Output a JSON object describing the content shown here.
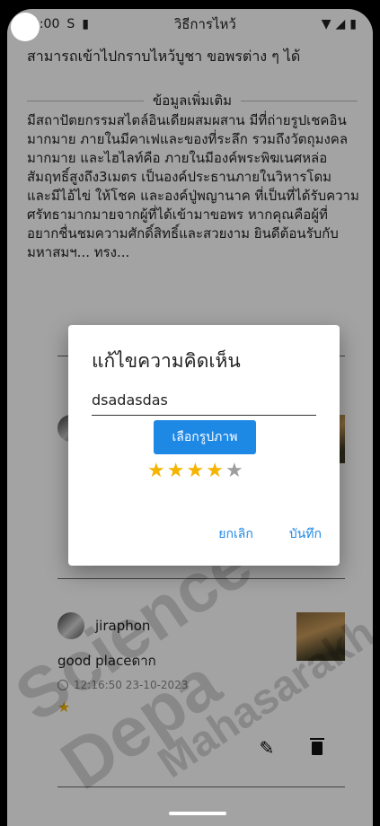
{
  "status_bar": {
    "time": "12:00",
    "title": "วิธีการไหว้",
    "icons": [
      "sim-icon",
      "sd-card-icon",
      "wifi-icon",
      "signal-icon",
      "battery-icon"
    ]
  },
  "page": {
    "top_text": "สามารถเข้าไปกราบไหว้บูชา ขอพรต่าง ๆ ได้",
    "section_title": "ข้อมูลเพิ่มเติม",
    "info_text": "มีสถาปัตยกรรมสไตล์อินเดียผสมผสาน มีที่ถ่ายรูปเชคอิน มากมาย ภายในมีคาเฟและของที่ระลึก รวมถึงวัตถุมงคลมากมาย และไฮไลท์คือ ภายในมีองค์พระพิฆเนศหล่อสัมฤทธิ์สูงถึง3เมตร เป็นองค์ประธานภายในวิหารโดม และมีไอ้ไข่ ให้โชค และองค์ปู่พญานาค ที่เป็นที่ได้รับความศรัทธามากมายจากผู้ที่ได้เข้ามาขอพร หากคุณคือผู้ที่อยากชื่นชมความศักดิ์สิทธิ์และสวยงาม ยินดีต้อนรับกับ มหาสมฯ... ทรง..."
  },
  "review": {
    "username": "jiraphon",
    "comment": "good placeดาก",
    "time": "12:16:50 23-10-2023",
    "rating": 1
  },
  "dialog": {
    "title": "แก้ไขความคิดเห็น",
    "input_value": "dsadasdas",
    "choose_image_label": "เลือกรูปภาพ",
    "rating": 4,
    "max_rating": 5,
    "cancel_label": "ยกเลิก",
    "save_label": "บันทึก"
  },
  "watermark": {
    "line1": "Science Depa",
    "line2": "Mahasarakh"
  },
  "colors": {
    "accent": "#1e88e5",
    "star": "#f4b400",
    "star_off": "#9e9e9e"
  }
}
